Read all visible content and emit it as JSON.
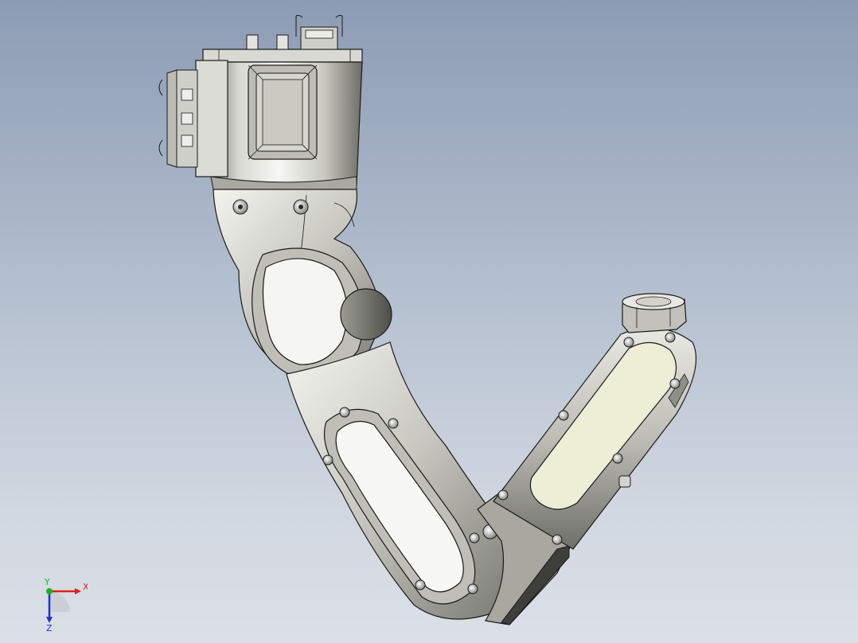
{
  "view": {
    "type": "cad-3d-model-viewport",
    "subject": "six-axis-robot-arm-isometric"
  },
  "triad": {
    "x_label": "X",
    "y_label": "Y",
    "z_label": "Z",
    "colors": {
      "x": "#e02020",
      "y": "#18b818",
      "z": "#2030d8"
    }
  },
  "colors": {
    "background_top": "#8c9cb4",
    "background_bottom": "#dbe0e7",
    "metal_light": "#f2f2ec",
    "metal_mid": "#c9c9c2",
    "metal_dark": "#6e6e68",
    "cover_panel": "#eeedd6",
    "outline": "#1a1a1a"
  }
}
